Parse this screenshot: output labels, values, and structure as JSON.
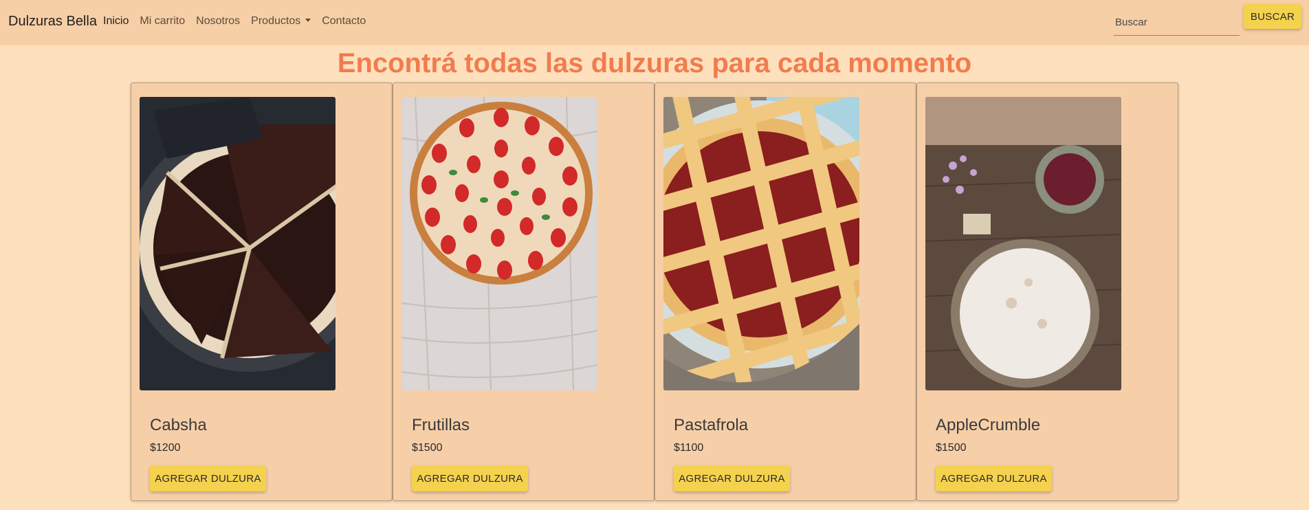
{
  "nav": {
    "brand": "Dulzuras Bella",
    "links": [
      {
        "label": "Inicio"
      },
      {
        "label": "Mi carrito"
      },
      {
        "label": "Nosotros"
      },
      {
        "label": "Productos"
      },
      {
        "label": "Contacto"
      }
    ],
    "search_placeholder": "Buscar",
    "search_button": "BUSCAR"
  },
  "heading": "Encontrá todas las dulzuras para cada momento",
  "products": [
    {
      "name": "Cabsha",
      "price": "$1200",
      "button": "AGREGAR DULZURA"
    },
    {
      "name": "Frutillas",
      "price": "$1500",
      "button": "AGREGAR DULZURA"
    },
    {
      "name": "Pastafrola",
      "price": "$1100",
      "button": "AGREGAR DULZURA"
    },
    {
      "name": "AppleCrumble",
      "price": "$1500",
      "button": "AGREGAR DULZURA"
    }
  ],
  "colors": {
    "page_bg": "#ffe0bd",
    "navbar_bg": "#f7cfa6",
    "accent_heading": "#f07c4e",
    "button_yellow": "#f5d24e"
  }
}
